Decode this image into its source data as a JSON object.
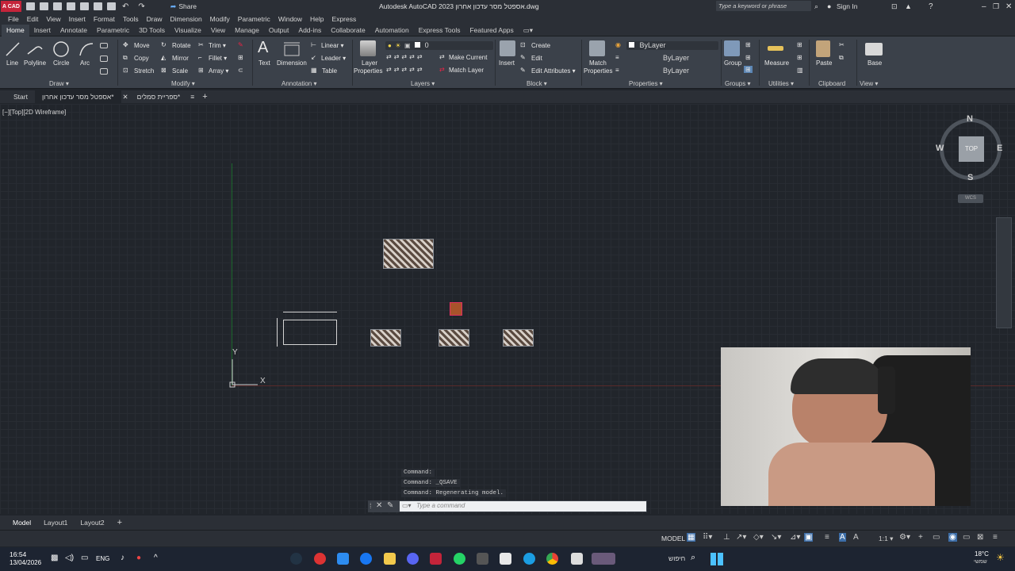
{
  "titlebar": {
    "logo": "A CAD",
    "share": "Share",
    "title": "Autodesk AutoCAD 2023  אספטל מסר עדכון אחרון.dwg",
    "search_placeholder": "Type a keyword or phrase",
    "sign_in": "Sign In"
  },
  "menubar": [
    "File",
    "Edit",
    "View",
    "Insert",
    "Format",
    "Tools",
    "Draw",
    "Dimension",
    "Modify",
    "Parametric",
    "Window",
    "Help",
    "Express"
  ],
  "ribbon_tabs": [
    "Home",
    "Insert",
    "Annotate",
    "Parametric",
    "3D Tools",
    "Visualize",
    "View",
    "Manage",
    "Output",
    "Add-ins",
    "Collaborate",
    "Automation",
    "Express Tools",
    "Featured Apps"
  ],
  "ribbon": {
    "draw": {
      "title": "Draw ▾",
      "line": "Line",
      "polyline": "Polyline",
      "circle": "Circle",
      "arc": "Arc"
    },
    "modify": {
      "title": "Modify ▾",
      "move": "Move",
      "rotate": "Rotate",
      "trim": "Trim ▾",
      "copy": "Copy",
      "mirror": "Mirror",
      "fillet": "Fillet ▾",
      "stretch": "Stretch",
      "scale": "Scale",
      "array": "Array ▾"
    },
    "annotation": {
      "title": "Annotation ▾",
      "text": "Text",
      "dimension": "Dimension",
      "linear": "Linear ▾",
      "leader": "Leader ▾",
      "table": "Table"
    },
    "layers": {
      "title": "Layers ▾",
      "layer_properties": "Layer",
      "layer_properties2": "Properties",
      "layer_value": "0",
      "make_current": "Make Current",
      "match_layer": "Match Layer"
    },
    "block": {
      "title": "Block ▾",
      "insert": "Insert",
      "create": "Create",
      "edit": "Edit",
      "edit_attributes": "Edit Attributes ▾"
    },
    "properties": {
      "title": "Properties ▾",
      "match": "Match",
      "match2": "Properties",
      "color": "ByLayer",
      "linetype": "ByLayer",
      "lineweight": "ByLayer"
    },
    "groups": {
      "title": "Groups ▾",
      "group": "Group"
    },
    "utilities": {
      "title": "Utilities ▾",
      "measure": "Measure"
    },
    "clipboard": {
      "title": "Clipboard",
      "paste": "Paste"
    },
    "view": {
      "title": "View ▾",
      "base": "Base"
    }
  },
  "file_tabs": {
    "start": "Start",
    "tab1": "אספטל מסר עדכון אחרון*",
    "tab2": "ספריית סמלים*"
  },
  "viewport_label": "[−][Top][2D Wireframe]",
  "viewcube": {
    "n": "N",
    "s": "S",
    "e": "E",
    "w": "W",
    "face": "TOP",
    "wcs": "WCS"
  },
  "ucs": {
    "x": "X",
    "y": "Y"
  },
  "command_history": [
    "Command:",
    "Command: _QSAVE",
    "Command: Regenerating model."
  ],
  "command_placeholder": "Type a command",
  "layout_tabs": [
    "Model",
    "Layout1",
    "Layout2"
  ],
  "status": {
    "model": "MODEL",
    "scale": "1:1 ▾"
  },
  "taskbar": {
    "time": "16:54",
    "date": "13/04/2026",
    "lang": "ENG",
    "search": "חיפוש",
    "weather_temp": "18°C",
    "weather_text": "שמשי"
  }
}
